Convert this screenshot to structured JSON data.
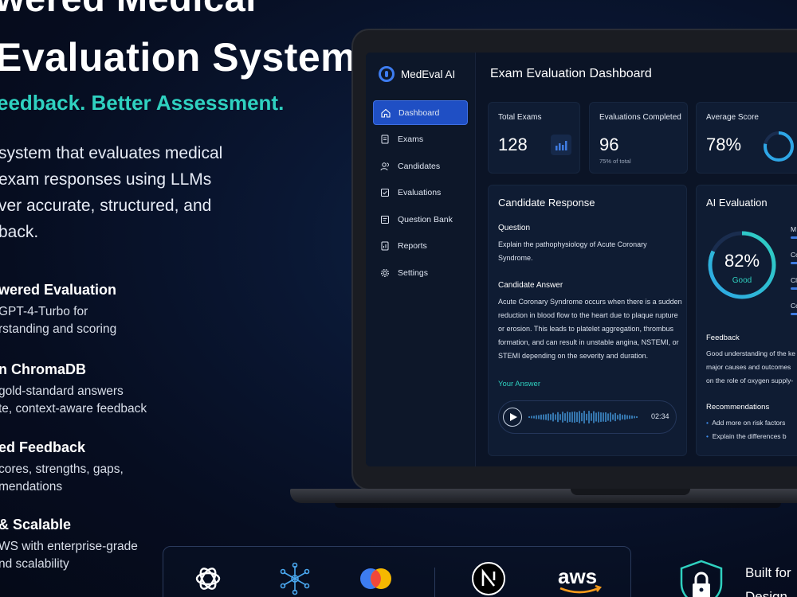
{
  "hero": {
    "title_line1": "wered Medical",
    "title_line2": "Evaluation System",
    "tagline": "eedback. Better Assessment.",
    "description": [
      "system that evaluates medical",
      "exam responses using LLMs",
      "ver accurate, structured, and",
      "back."
    ],
    "features": [
      {
        "title": "wered Evaluation",
        "lines": [
          "GPT-4-Turbo for",
          "rstanding and scoring"
        ]
      },
      {
        "title": "n ChromaDB",
        "lines": [
          "gold-standard answers",
          "te, context-aware feedback"
        ]
      },
      {
        "title": "ed Feedback",
        "lines": [
          "cores, strengths, gaps,",
          "mendations"
        ]
      },
      {
        "title": "& Scalable",
        "lines": [
          "WS with enterprise-grade",
          "nd scalability"
        ]
      }
    ]
  },
  "app": {
    "brand": "MedEval AI",
    "nav": [
      {
        "label": "Dashboard",
        "icon": "home-icon",
        "active": true
      },
      {
        "label": "Exams",
        "icon": "document-icon",
        "active": false
      },
      {
        "label": "Candidates",
        "icon": "users-icon",
        "active": false
      },
      {
        "label": "Evaluations",
        "icon": "checklist-icon",
        "active": false
      },
      {
        "label": "Question Bank",
        "icon": "question-bank-icon",
        "active": false
      },
      {
        "label": "Reports",
        "icon": "report-icon",
        "active": false
      },
      {
        "label": "Settings",
        "icon": "gear-icon",
        "active": false
      }
    ],
    "dashboard_title": "Exam Evaluation Dashboard",
    "stats": [
      {
        "label": "Total Exams",
        "value": "128",
        "sub": ""
      },
      {
        "label": "Evaluations Completed",
        "value": "96",
        "sub": "75% of total"
      },
      {
        "label": "Average Score",
        "value": "78%",
        "sub": "",
        "fraction": 0.78
      }
    ],
    "response": {
      "title": "Candidate Response",
      "question_label": "Question",
      "question": [
        "Explain the pathophysiology of Acute Coronary",
        "Syndrome."
      ],
      "answer_label": "Candidate Answer",
      "answer": [
        "Acute Coronary Syndrome occurs when there is a sudden",
        "reduction in blood flow to the heart due to plaque rupture",
        "or erosion. This leads to platelet aggregation, thrombus",
        "formation, and can result in unstable angina, NSTEMI, or",
        "STEMI depending on the severity and duration."
      ],
      "your_answer_label": "Your Answer",
      "audio_duration": "02:34"
    },
    "evaluation": {
      "title": "AI Evaluation",
      "score": "82%",
      "score_fraction": 0.82,
      "rating": "Good",
      "criteria_initials": [
        "M",
        "Co",
        "Cl",
        "Co"
      ],
      "feedback_label": "Feedback",
      "feedback": [
        "Good understanding of the ke",
        "major causes and outcomes",
        "on the role of oxygen supply-"
      ],
      "recommendations_label": "Recommendations",
      "recommendations": [
        "Add more on risk factors",
        "Explain the differences b"
      ]
    }
  },
  "bottom": {
    "built_line1": "Built for",
    "built_line2": "Design"
  },
  "colors": {
    "accent_teal": "#2fd1c0",
    "accent_blue": "#1f4fc4",
    "background": "#0a1733"
  }
}
